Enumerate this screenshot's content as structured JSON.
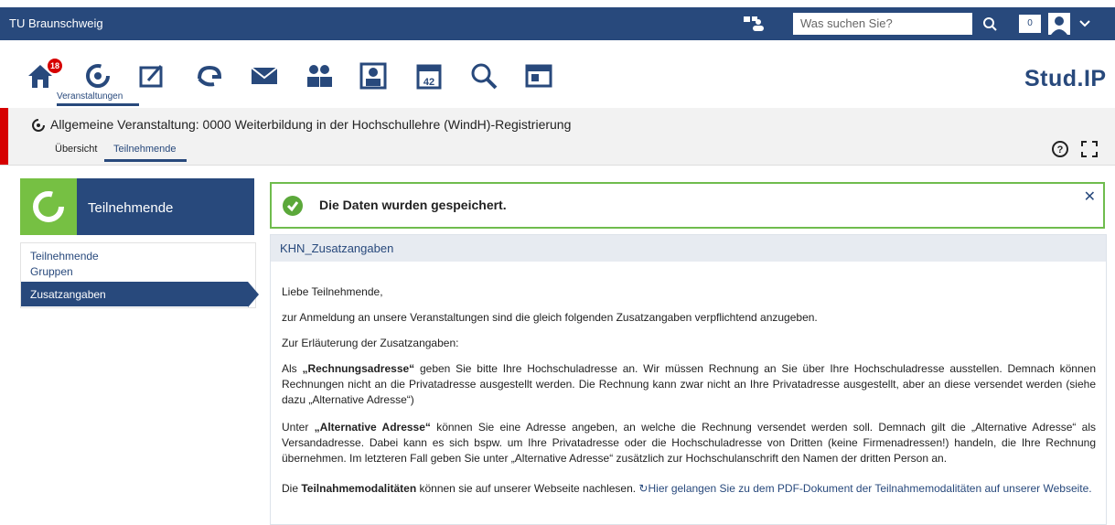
{
  "header": {
    "brand": "TU Braunschweig",
    "search_placeholder": "Was suchen Sie?",
    "counter": "0"
  },
  "nav": {
    "badge": "18",
    "active_label": "Veranstaltungen",
    "logo": "Stud.IP"
  },
  "course": {
    "title": "Allgemeine Veranstaltung: 0000 Weiterbildung in der Hochschullehre (WindH)-Registrierung",
    "tabs": [
      "Übersicht",
      "Teilnehmende"
    ]
  },
  "sidebar": {
    "title": "Teilnehmende",
    "items": [
      "Teilnehmende",
      "Gruppen",
      "Zusatzangaben"
    ]
  },
  "message": {
    "text": "Die Daten wurden gespeichert."
  },
  "panel": {
    "title": "KHN_Zusatzangaben",
    "p1": "Liebe Teilnehmende,",
    "p2": "zur Anmeldung an unsere Veranstaltungen sind die gleich folgenden Zusatzangaben verpflichtend anzugeben.",
    "p3": "Zur Erläuterung der Zusatzangaben:",
    "p4_label": "„Rechnungsadresse“",
    "p4_prefix": "Als ",
    "p4_rest": " geben Sie bitte Ihre Hochschuladresse an. Wir müssen Rechnung an Sie über Ihre Hochschuladresse ausstellen. Demnach können Rechnungen nicht an die Privatadresse ausgestellt werden. Die Rechnung kann zwar nicht an Ihre Privatadresse ausgestellt, aber an diese versendet werden (siehe dazu „Alternative Adresse“)",
    "p5_prefix": "Unter ",
    "p5_label": "„Alternative Adresse“",
    "p5_rest": " können Sie eine Adresse angeben, an welche die Rechnung versendet werden soll. Demnach gilt die „Alternative Adresse“ als Versandadresse. Dabei kann es sich bspw. um Ihre Privatadresse oder die Hochschuladresse von Dritten (keine Firmenadressen!) handeln, die Ihre Rechnung übernehmen. Im letzteren Fall geben Sie unter „Alternative Adresse“ zusätzlich zur Hochschulanschrift den Namen der dritten Person an.",
    "p6_prefix": "Die ",
    "p6_label": "Teilnahmemodalitäten",
    "p6_rest": " können sie auf unserer Webseite nachlesen. ",
    "p6_link": "Hier gelangen Sie zu dem PDF-Dokument der Teilnahmemodalitäten auf unserer Webseite."
  }
}
